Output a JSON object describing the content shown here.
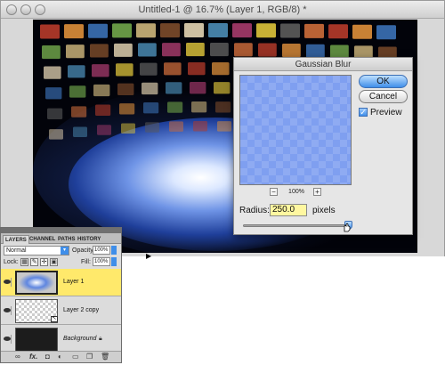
{
  "document": {
    "title": "Untitled-1 @ 16.7% (Layer 1, RGB/8) *"
  },
  "gaussian_blur": {
    "title": "Gaussian Blur",
    "ok_label": "OK",
    "cancel_label": "Cancel",
    "preview_label": "Preview",
    "preview_checked": true,
    "zoom_out": "−",
    "zoom_level": "100%",
    "zoom_in": "+",
    "radius_label": "Radius:",
    "radius_value": "250.0",
    "radius_unit": "pixels"
  },
  "layers_panel": {
    "tabs": [
      "LAYERS",
      "CHANNEL",
      "PATHS",
      "HISTORY"
    ],
    "blend_mode": "Normal",
    "opacity_label": "Opacity:",
    "opacity_value": "100%",
    "lock_label": "Lock:",
    "fill_label": "Fill:",
    "fill_value": "100%",
    "layers": [
      {
        "name": "Layer 1",
        "selected": true,
        "style": "normal"
      },
      {
        "name": "Layer 2 copy",
        "selected": false,
        "style": "normal"
      },
      {
        "name": "Background",
        "selected": false,
        "style": "italic",
        "locked": true
      }
    ],
    "bottom_icons": [
      "link-icon",
      "fx-icon",
      "mask-icon",
      "adjustment-icon",
      "folder-icon",
      "new-layer-icon",
      "trash-icon"
    ],
    "bottom_icon_glyphs": {
      "fx": "fx."
    }
  },
  "colors": {
    "selected_layer": "#ffe96b",
    "accent_blue": "#3f8ee9",
    "radius_field": "#fff7a0",
    "canvas_bg": "#02030a"
  }
}
